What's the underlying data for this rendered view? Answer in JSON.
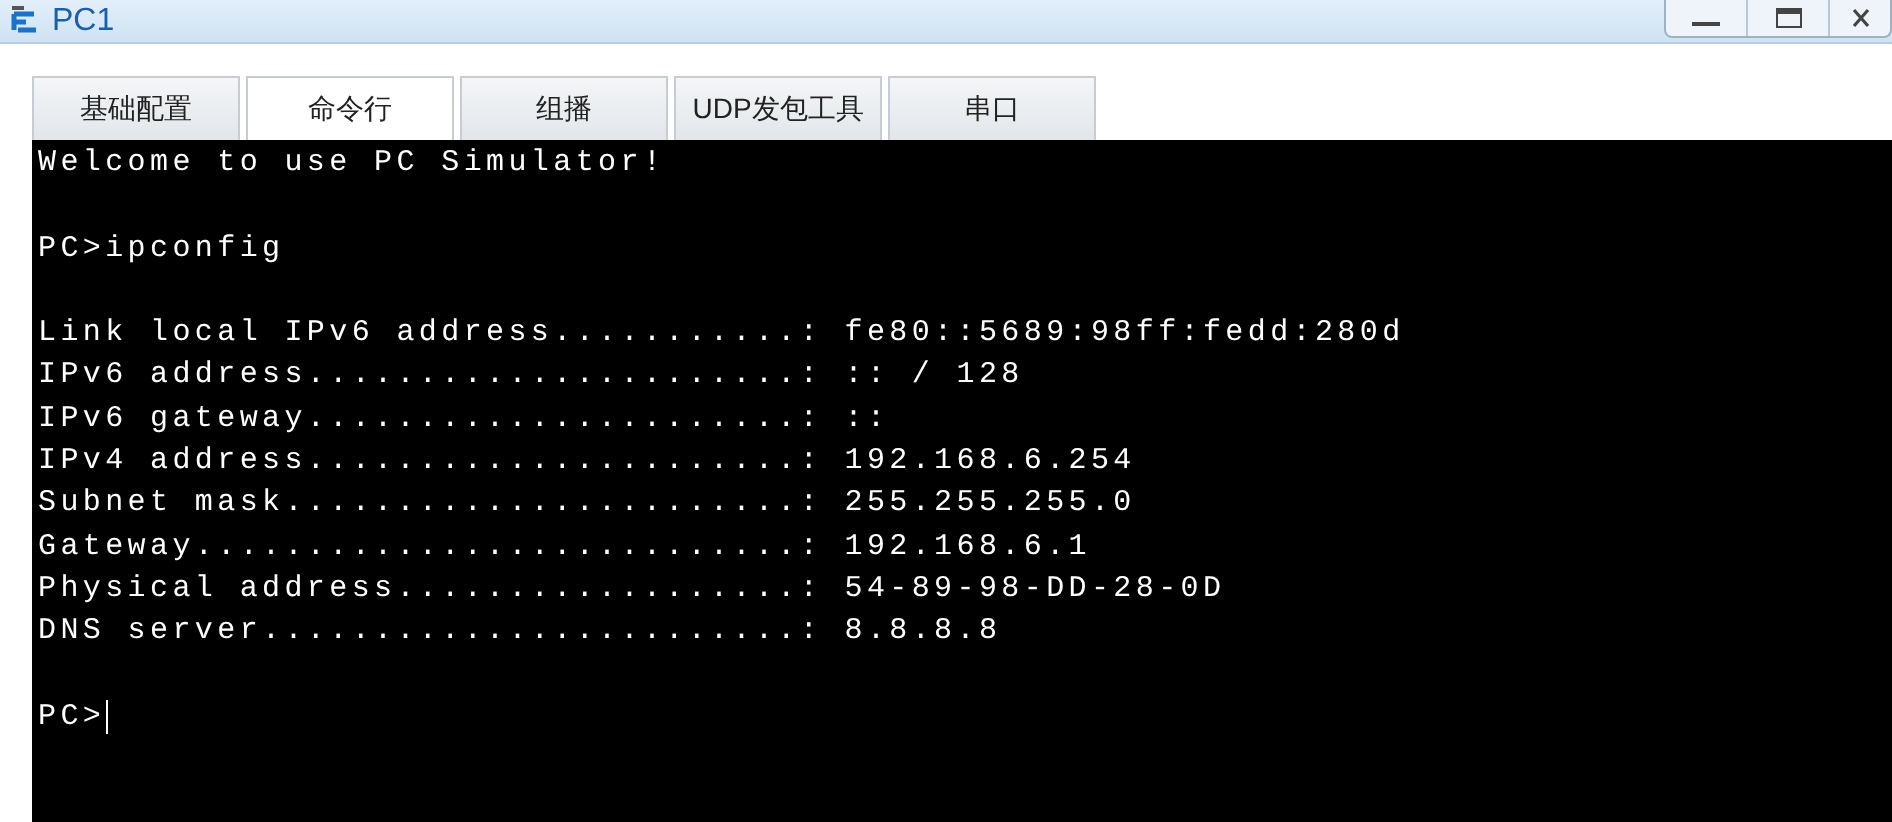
{
  "window": {
    "title": "PC1"
  },
  "tabs": [
    {
      "label": "基础配置",
      "selected": false
    },
    {
      "label": "命令行",
      "selected": true
    },
    {
      "label": "组播",
      "selected": false
    },
    {
      "label": "UDP发包工具",
      "selected": false
    },
    {
      "label": "串口",
      "selected": false
    }
  ],
  "terminal": {
    "blocks": [
      [
        "Welcome to use PC Simulator!"
      ],
      [
        "PC>ipconfig"
      ],
      [
        "Link local IPv6 address...........: fe80::5689:98ff:fedd:280d",
        "IPv6 address......................: :: / 128",
        "IPv6 gateway......................: ::",
        "IPv4 address......................: 192.168.6.254",
        "Subnet mask.......................: 255.255.255.0",
        "Gateway...........................: 192.168.6.1",
        "Physical address..................: 54-89-98-DD-28-0D",
        "DNS server........................: 8.8.8.8"
      ]
    ],
    "prompt": "PC>"
  }
}
